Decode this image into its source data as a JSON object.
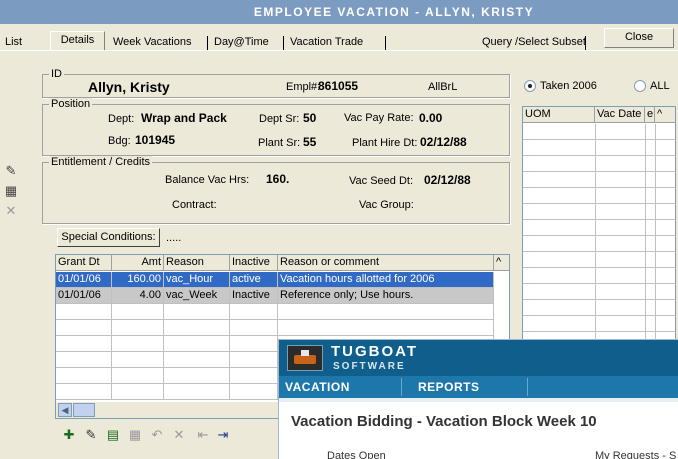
{
  "window": {
    "title": "EMPLOYEE VACATION - ALLYN, KRISTY"
  },
  "tabs": {
    "list": "List",
    "details": "Details",
    "week_vacations": "Week Vacations",
    "day_time": "Day@Time",
    "vacation_trade": "Vacation Trade",
    "query": "Query /Select Subset",
    "close": "Close"
  },
  "id_group": {
    "label": "ID",
    "name": "Allyn, Kristy",
    "emplno_label": "Empl#:",
    "emplno": "861055",
    "code": "AllBrL"
  },
  "position": {
    "label": "Position",
    "dept_label": "Dept:",
    "dept": "Wrap and Pack",
    "dept_sr_label": "Dept Sr:",
    "dept_sr": "50",
    "vac_pay_label": "Vac Pay Rate:",
    "vac_pay": "0.00",
    "bdg_label": "Bdg:",
    "bdg": "101945",
    "plant_sr_label": "Plant Sr:",
    "plant_sr": "55",
    "plant_hire_label": "Plant Hire Dt:",
    "plant_hire": "02/12/88"
  },
  "entitlement": {
    "label": "Entitlement / Credits",
    "balance_label": "Balance Vac Hrs:",
    "balance": "160.",
    "seed_label": "Vac Seed Dt:",
    "seed": "02/12/88",
    "contract_label": "Contract:",
    "group_label": "Vac Group:",
    "special_button": "Special Conditions:",
    "special_value": "....."
  },
  "grants": {
    "headers": [
      "Grant Dt",
      "Amt",
      "Reason",
      "Inactive",
      "Reason or comment"
    ],
    "rows": [
      {
        "date": "01/01/06",
        "amt": "160.00",
        "reason": "vac_Hour",
        "inactive": "active",
        "comment": "Vacation hours allotted for 2006"
      },
      {
        "date": "01/01/06",
        "amt": "4.00",
        "reason": "vac_Week",
        "inactive": "Inactive",
        "comment": "Reference only; Use hours."
      }
    ]
  },
  "filter": {
    "taken": "Taken 2006",
    "all": "ALL"
  },
  "right_grid": {
    "headers": [
      "UOM",
      "Vac Date",
      "e"
    ]
  },
  "overlay": {
    "brand_top": "TUGBOAT",
    "brand_bottom": "SOFTWARE",
    "nav": [
      "VACATION",
      "REPORTS"
    ],
    "heading": "Vacation Bidding - Vacation Block Week 10",
    "dates_open": "Dates Open",
    "my_requests": "My Requests - S"
  },
  "colors": {
    "title_bar": "#7b9bc1",
    "selection": "#316ac5",
    "inactive_row": "#c8c8c8",
    "tugboat_header": "#0f5e8c",
    "tugboat_nav": "#1d77ab"
  }
}
